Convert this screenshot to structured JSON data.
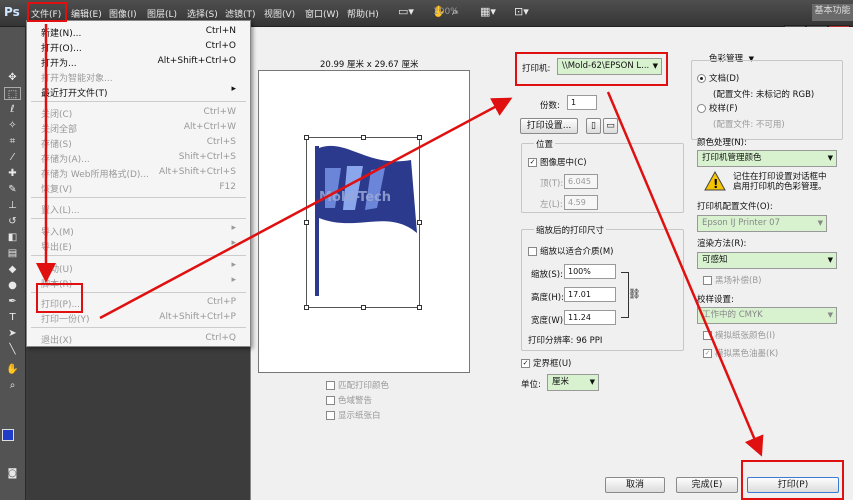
{
  "app": {
    "logo": "Ps"
  },
  "menubar": {
    "items": [
      "文件(F)",
      "编辑(E)",
      "图像(I)",
      "图层(L)",
      "选择(S)",
      "滤镜(T)",
      "视图(V)",
      "窗口(W)",
      "帮助(H)"
    ],
    "zoom": "100%",
    "workspace": "基本功能"
  },
  "file_menu": {
    "items": [
      {
        "label": "新建(N)...",
        "shortcut": "Ctrl+N"
      },
      {
        "label": "打开(O)...",
        "shortcut": "Ctrl+O"
      },
      {
        "label": "打开为...",
        "shortcut": "Alt+Shift+Ctrl+O"
      },
      {
        "label": "打开为智能对象...",
        "shortcut": ""
      },
      {
        "label": "最近打开文件(T)",
        "shortcut": ""
      },
      {
        "label": "关闭(C)",
        "shortcut": "Ctrl+W"
      },
      {
        "label": "关闭全部",
        "shortcut": "Alt+Ctrl+W"
      },
      {
        "label": "存储(S)",
        "shortcut": "Ctrl+S"
      },
      {
        "label": "存储为(A)...",
        "shortcut": "Shift+Ctrl+S"
      },
      {
        "label": "存储为 Web所用格式(D)...",
        "shortcut": "Alt+Shift+Ctrl+S"
      },
      {
        "label": "恢复(V)",
        "shortcut": "F12"
      },
      {
        "label": "置入(L)...",
        "shortcut": ""
      },
      {
        "label": "导入(M)",
        "shortcut": ""
      },
      {
        "label": "导出(E)",
        "shortcut": ""
      },
      {
        "label": "自动(U)",
        "shortcut": ""
      },
      {
        "label": "脚本(R)",
        "shortcut": ""
      },
      {
        "label": "打印(P)...",
        "shortcut": "Ctrl+P"
      },
      {
        "label": "打印一份(Y)",
        "shortcut": "Alt+Shift+Ctrl+P"
      },
      {
        "label": "退出(X)",
        "shortcut": "Ctrl+Q"
      }
    ]
  },
  "preview": {
    "size_label": "20.99 厘米 x 29.67 厘米",
    "watermark": "Mold-Tech",
    "options": [
      "匹配打印颜色",
      "色域警告",
      "显示纸张白"
    ]
  },
  "printer": {
    "label": "打印机:",
    "value": "\\\\Mold-62\\EPSON L...",
    "copies_label": "份数:",
    "copies": "1",
    "setup_button": "打印设置..."
  },
  "position": {
    "title": "位置",
    "center_label": "图像居中(C)",
    "top_label": "顶(T):",
    "top_value": "6.045",
    "left_label": "左(L):",
    "left_value": "4.59"
  },
  "scaled": {
    "title": "缩放后的打印尺寸",
    "fit_label": "缩放以适合介质(M)",
    "scale_label": "缩放(S):",
    "scale_value": "100%",
    "height_label": "高度(H):",
    "height_value": "17.01",
    "width_label": "宽度(W):",
    "width_value": "11.24",
    "resolution": "打印分辨率: 96 PPI"
  },
  "bounding": {
    "label": "定界框(U)",
    "unit_label": "单位:",
    "unit_value": "厘米"
  },
  "color_mgmt": {
    "mode": "色彩管理",
    "document_label": "文档(D)",
    "document_profile": "(配置文件: 未标记的 RGB)",
    "proof_label": "校样(F)",
    "proof_profile": "(配置文件: 不可用)",
    "handling_label": "颜色处理(N):",
    "handling_value": "打印机管理颜色",
    "warning": "记住在打印设置对话框中启用打印机的色彩管理。",
    "printer_profile_label": "打印机配置文件(O):",
    "printer_profile_value": "Epson IJ Printer 07",
    "intent_label": "渲染方法(R):",
    "intent_value": "可感知",
    "bpc_label": "黑场补偿(B)",
    "proof_setup_label": "校样设置:",
    "proof_setup_value": "工作中的 CMYK",
    "simulate_paper": "模拟纸张颜色(I)",
    "simulate_ink": "模拟黑色油墨(K)"
  },
  "footer": {
    "cancel": "取消",
    "done": "完成(E)",
    "print": "打印(P)"
  },
  "colors": {
    "highlight": "#e01010",
    "flag": "#2b3a8c",
    "green_field": "#d8f2d0"
  }
}
